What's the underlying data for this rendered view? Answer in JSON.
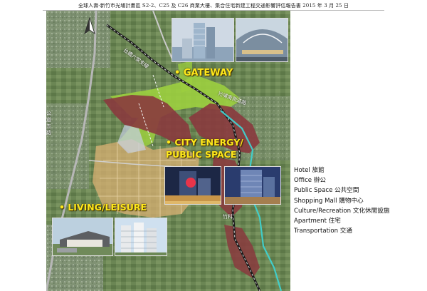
{
  "header": {
    "title": "全球人壽-新竹市光埔計畫區 S2-2、C25 及 C26 商業大樓、集合住宅新建工程交通影響評估報告書",
    "date": "2015 年 3 月 25 日"
  },
  "map": {
    "labels": {
      "gateway": "• GATEWAY",
      "city_line1": "• CITY ENERGY/",
      "city_line2": "PUBLIC SPACE",
      "living": "• LIVING/LEISURE"
    },
    "roads": {
      "railway": "台鐵六家支線",
      "expressway": "公道五路",
      "river": "竹科",
      "east_road": "光埔南側道路"
    }
  },
  "legend": {
    "items": [
      "Hotel 旅館",
      "Office 辦公",
      "Public Space 公共空間",
      "Shopping Mall 購物中心",
      "Culture/Recreation 文化休閒設施",
      "Apartment 住宅",
      "Transportation 交通"
    ]
  },
  "colors": {
    "project_zone": "#8a3a3e",
    "green_zone": "#9ccf3f",
    "residential_zone": "#d9b073",
    "river": "#3fd1cf",
    "label_yellow": "#ffe81a"
  },
  "icons": {
    "north_arrow": "north-arrow-icon"
  }
}
